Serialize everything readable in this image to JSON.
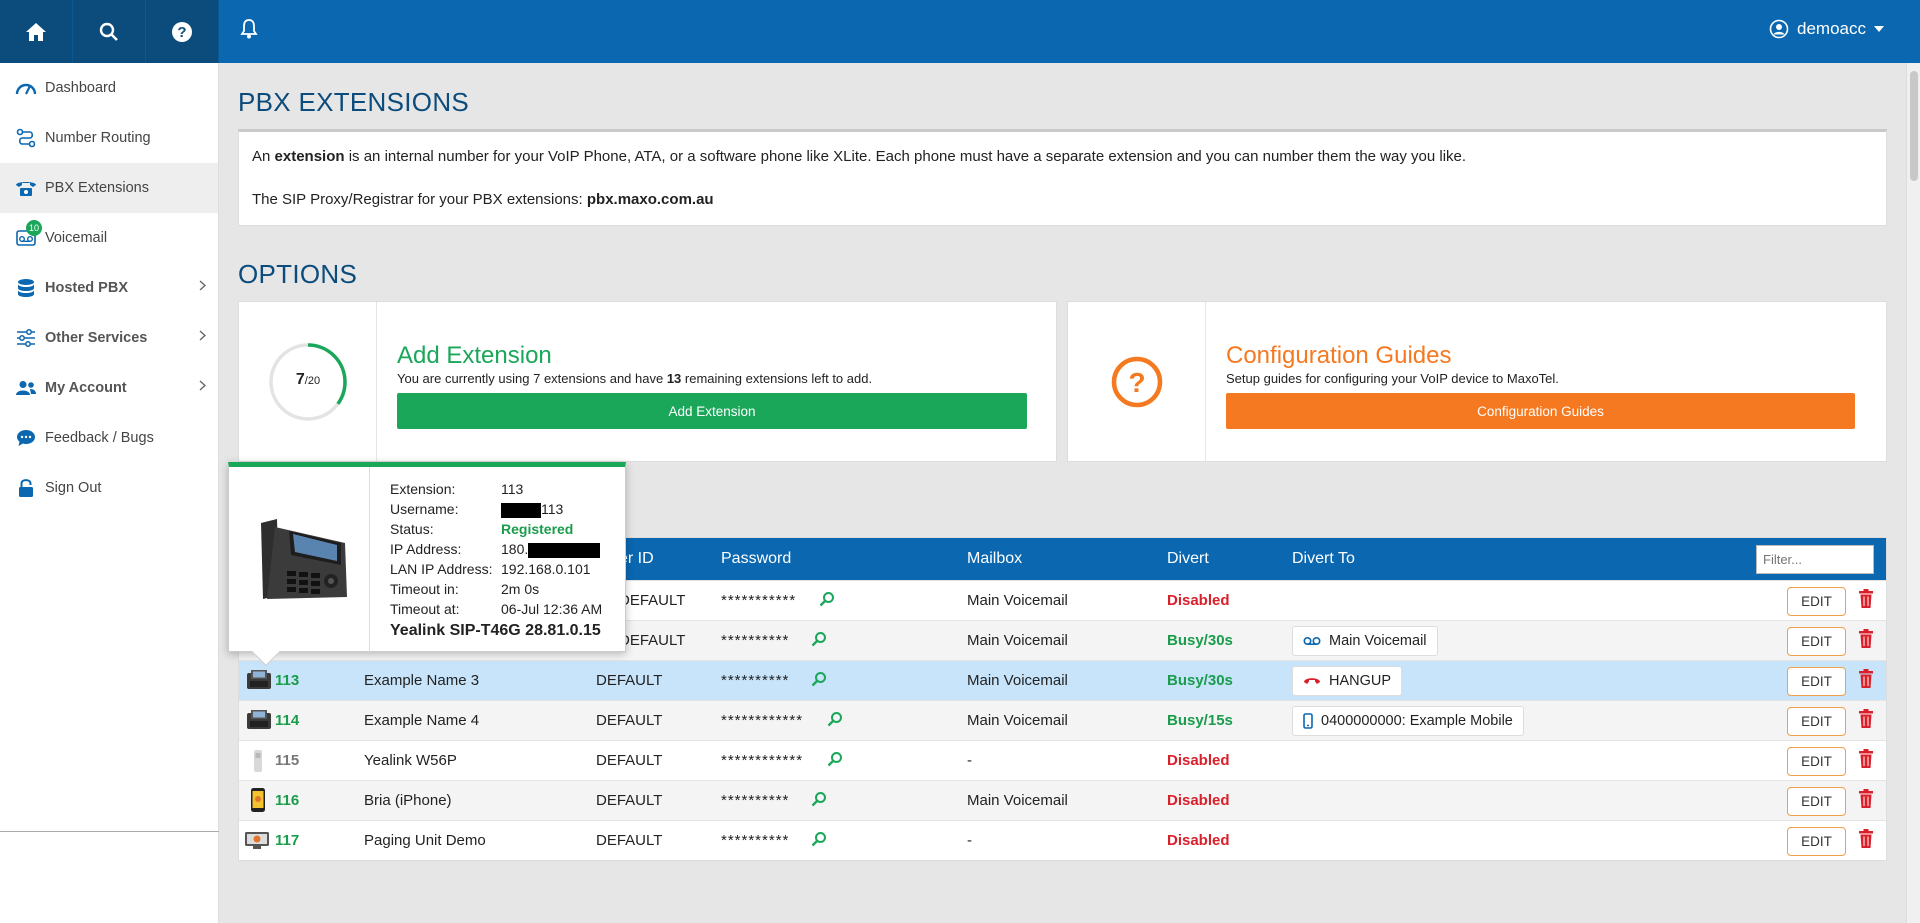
{
  "topbar": {
    "username": "demoacc",
    "icons": [
      "home-icon",
      "search-icon",
      "help-icon",
      "bell-icon"
    ]
  },
  "sidebar": {
    "items": [
      {
        "label": "Dashboard",
        "icon": "speedometer-icon"
      },
      {
        "label": "Number Routing",
        "icon": "routing-icon"
      },
      {
        "label": "PBX Extensions",
        "icon": "phone-icon"
      },
      {
        "label": "Voicemail",
        "icon": "voicemail-icon",
        "badge": "10"
      },
      {
        "label": "Hosted PBX",
        "icon": "database-icon"
      },
      {
        "label": "Other Services",
        "icon": "sliders-icon"
      },
      {
        "label": "My Account",
        "icon": "users-icon"
      },
      {
        "label": "Feedback / Bugs",
        "icon": "chat-icon"
      },
      {
        "label": "Sign Out",
        "icon": "lock-icon"
      }
    ]
  },
  "page": {
    "title": "PBX EXTENSIONS",
    "info_line1_pre": "An ",
    "info_line1_bold": "extension",
    "info_line1_post": " is an internal number for your VoIP Phone, ATA, or a software phone like XLite. Each phone must have a separate extension and you can number them the way you like.",
    "info_line2_pre": "The SIP Proxy/Registrar for your PBX extensions: ",
    "info_line2_bold": "pbx.maxo.com.au",
    "options_title": "OPTIONS"
  },
  "add_card": {
    "used": "7",
    "total": "/20",
    "title": "Add Extension",
    "desc_pre": "You are currently using ",
    "desc_used": "7",
    "desc_mid": " extensions and have ",
    "desc_remaining": "13",
    "desc_post": " remaining extensions left to add.",
    "button": "Add Extension",
    "color": "#1ba75a"
  },
  "guide_card": {
    "title": "Configuration Guides",
    "desc": "Setup guides for configuring your VoIP device to MaxoTel.",
    "button": "Configuration Guides",
    "color": "#f47920"
  },
  "table": {
    "headers": {
      "caller_id": "er ID",
      "password": "Password",
      "mailbox": "Mailbox",
      "divert": "Divert",
      "divert_to": "Divert To"
    },
    "filter_placeholder": "Filter...",
    "edit_label": "EDIT",
    "rows": [
      {
        "ext": "",
        "name": "",
        "caller": "DEFAULT",
        "pw": "***********",
        "mailbox": "Main Voicemail",
        "divert": "Disabled",
        "divert_to": ""
      },
      {
        "ext": "",
        "name": "",
        "caller": "DEFAULT",
        "pw": "**********",
        "mailbox": "Main Voicemail",
        "divert": "Busy/30s",
        "divert_to": "Main Voicemail"
      },
      {
        "ext": "113",
        "name": "Example Name 3",
        "caller": "DEFAULT",
        "pw": "**********",
        "mailbox": "Main Voicemail",
        "divert": "Busy/30s",
        "divert_to": "HANGUP"
      },
      {
        "ext": "114",
        "name": "Example Name 4",
        "caller": "DEFAULT",
        "pw": "************",
        "mailbox": "Main Voicemail",
        "divert": "Busy/15s",
        "divert_to": "0400000000: Example Mobile"
      },
      {
        "ext": "115",
        "name": "Yealink W56P",
        "caller": "DEFAULT",
        "pw": "************",
        "mailbox": "-",
        "divert": "Disabled",
        "divert_to": ""
      },
      {
        "ext": "116",
        "name": "Bria (iPhone)",
        "caller": "DEFAULT",
        "pw": "**********",
        "mailbox": "Main Voicemail",
        "divert": "Disabled",
        "divert_to": ""
      },
      {
        "ext": "117",
        "name": "Paging Unit Demo",
        "caller": "DEFAULT",
        "pw": "**********",
        "mailbox": "-",
        "divert": "Disabled",
        "divert_to": ""
      }
    ]
  },
  "popover": {
    "labels": {
      "extension": "Extension:",
      "username": "Username:",
      "status": "Status:",
      "ip": "IP Address:",
      "lan_ip": "LAN IP Address:",
      "timeout_in": "Timeout in:",
      "timeout_at": "Timeout at:"
    },
    "values": {
      "extension": "113",
      "username_suffix": "113",
      "status": "Registered",
      "ip_prefix": "180.",
      "lan_ip": "192.168.0.101",
      "timeout_in": "2m 0s",
      "timeout_at": "06-Jul 12:36 AM"
    },
    "model": "Yealink SIP-T46G 28.81.0.15"
  }
}
